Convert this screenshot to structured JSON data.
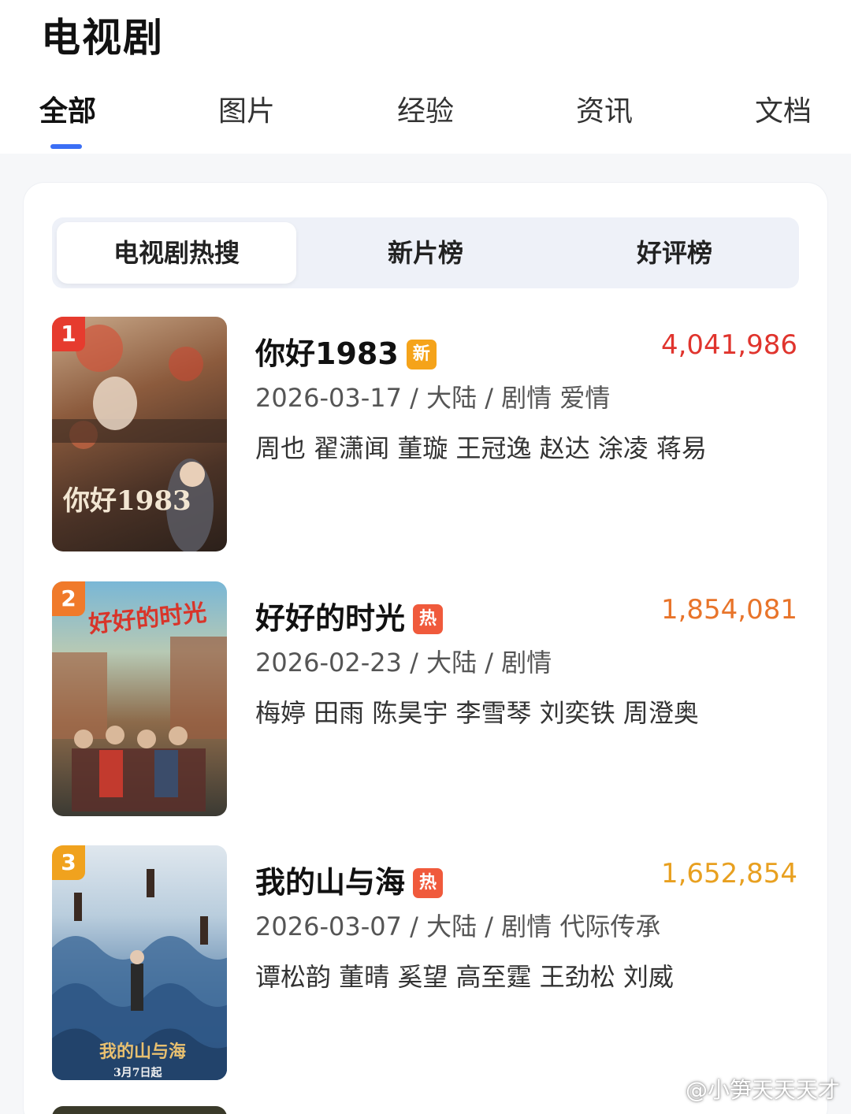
{
  "header": {
    "title": "电视剧"
  },
  "tabs": [
    {
      "label": "全部",
      "active": true
    },
    {
      "label": "图片",
      "active": false
    },
    {
      "label": "经验",
      "active": false
    },
    {
      "label": "资讯",
      "active": false
    },
    {
      "label": "文档",
      "active": false
    }
  ],
  "accent_color": "#3b6ff5",
  "segments": [
    {
      "label": "电视剧热搜",
      "active": true
    },
    {
      "label": "新片榜",
      "active": false
    },
    {
      "label": "好评榜",
      "active": false
    }
  ],
  "shows": [
    {
      "rank": "1",
      "name": "你好1983",
      "badge": "新",
      "badge_color": "#f5a31a",
      "score": "4,041,986",
      "score_color": "#e0342d",
      "rank_color": "#e63b2e",
      "meta": "2026-03-17 / 大陆 / 剧情 爱情",
      "cast": "周也 翟潇闻 董璇 王冠逸 赵达 涂凌 蒋易",
      "poster_text": "你好1983"
    },
    {
      "rank": "2",
      "name": "好好的时光",
      "badge": "热",
      "badge_color": "#f05a3c",
      "score": "1,854,081",
      "score_color": "#e8742a",
      "rank_color": "#f07a2a",
      "meta": "2026-02-23 / 大陆 / 剧情",
      "cast": "梅婷 田雨 陈昊宇 李雪琴 刘奕铁 周澄奥",
      "poster_text": "好好的时光"
    },
    {
      "rank": "3",
      "name": "我的山与海",
      "badge": "热",
      "badge_color": "#f05a3c",
      "score": "1,652,854",
      "score_color": "#e8a020",
      "rank_color": "#f0a21e",
      "meta": "2026-03-07 / 大陆 / 剧情 代际传承",
      "cast": "谭松韵 董晴 奚望 高至霆 王劲松 刘威",
      "poster_text": "我的山与海",
      "poster_date": "3月7日起"
    }
  ],
  "watermark": "@小笋天天天才"
}
